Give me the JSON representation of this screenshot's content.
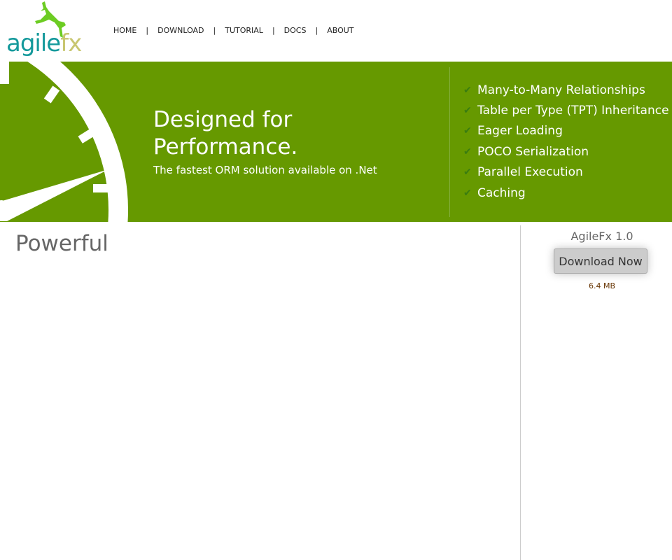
{
  "logo": {
    "part1": "agile",
    "part2": "fx"
  },
  "nav": [
    "HOME",
    "DOWNLOAD",
    "TUTORIAL",
    "DOCS",
    "ABOUT"
  ],
  "nav_separator": "|",
  "banner": {
    "headline": "Designed for Performance.",
    "subtitle": "The fastest ORM solution available on .Net",
    "features": [
      "Many-to-Many Relationships",
      "Table per Type (TPT) Inheritance",
      "Eager Loading",
      "POCO Serialization",
      "Parallel Execution",
      "Caching"
    ],
    "check": "✔"
  },
  "main": {
    "heading": "Powerful"
  },
  "sidebar": {
    "version": "AgileFx 1.0",
    "download_label": "Download Now",
    "size": "6.4 MB"
  },
  "colors": {
    "banner": "#669900",
    "logo_teal": "#14999b",
    "logo_fx": "#c8c670",
    "deer": "#6ccc22"
  }
}
